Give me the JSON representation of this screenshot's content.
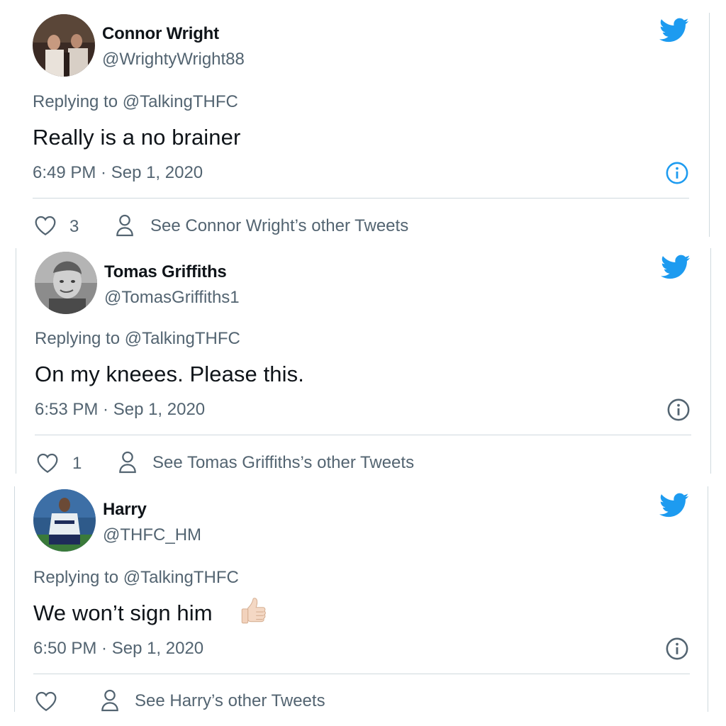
{
  "colors": {
    "twitter_blue": "#1d9bf0",
    "text_primary": "#0f1419",
    "text_secondary": "#536471",
    "divider": "#cfd9de"
  },
  "tweets": [
    {
      "display_name": "Connor Wright",
      "handle": "@WrightyWright88",
      "replying_prefix": "Replying to",
      "replying_to": "@TalkingTHFC",
      "text": "Really is a no brainer",
      "timestamp": "6:49 PM · Sep 1, 2020",
      "likes": "3",
      "see_other": "See Connor Wright’s other Tweets",
      "info_icon_color": "#1d9bf0"
    },
    {
      "display_name": "Tomas Griffiths",
      "handle": "@TomasGriffiths1",
      "replying_prefix": "Replying to",
      "replying_to": "@TalkingTHFC",
      "text": "On my kneees. Please this.",
      "timestamp": "6:53 PM · Sep 1, 2020",
      "likes": "1",
      "see_other": "See Tomas Griffiths’s other Tweets",
      "info_icon_color": "#536471"
    },
    {
      "display_name": "Harry",
      "handle": "@THFC_HM",
      "replying_prefix": "Replying to",
      "replying_to": "@TalkingTHFC",
      "text": "We won’t sign him",
      "emoji": "thumbs-up",
      "timestamp": "6:50 PM · Sep 1, 2020",
      "likes": "",
      "see_other": "See Harry’s other Tweets",
      "info_icon_color": "#536471"
    }
  ]
}
